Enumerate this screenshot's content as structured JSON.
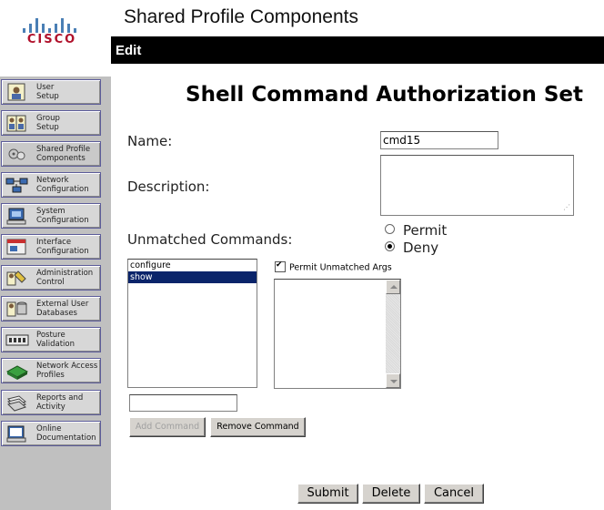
{
  "header": {
    "page_title": "Shared Profile Components",
    "edit_label": "Edit"
  },
  "logo": {
    "text": "CISCO",
    "color": "#b0112b"
  },
  "nav": {
    "items": [
      {
        "line1": "User",
        "line2": "Setup",
        "icon": "user-icon"
      },
      {
        "line1": "Group",
        "line2": "Setup",
        "icon": "group-icon"
      },
      {
        "line1": "Shared Profile",
        "line2": "Components",
        "icon": "shared-components-icon"
      },
      {
        "line1": "Network",
        "line2": "Configuration",
        "icon": "network-icon"
      },
      {
        "line1": "System",
        "line2": "Configuration",
        "icon": "system-icon"
      },
      {
        "line1": "Interface",
        "line2": "Configuration",
        "icon": "interface-icon"
      },
      {
        "line1": "Administration",
        "line2": "Control",
        "icon": "admin-icon"
      },
      {
        "line1": "External User",
        "line2": "Databases",
        "icon": "database-icon"
      },
      {
        "line1": "Posture",
        "line2": "Validation",
        "icon": "posture-icon"
      },
      {
        "line1": "Network Access",
        "line2": "Profiles",
        "icon": "network-access-icon"
      },
      {
        "line1": "Reports and",
        "line2": "Activity",
        "icon": "reports-icon"
      },
      {
        "line1": "Online",
        "line2": "Documentation",
        "icon": "docs-icon"
      }
    ]
  },
  "form": {
    "title": "Shell Command Authorization Set",
    "name_label": "Name:",
    "name_value": "cmd15",
    "description_label": "Description:",
    "description_value": "",
    "unmatched_label": "Unmatched Commands:",
    "permit_label": "Permit",
    "deny_label": "Deny",
    "selected_unmatched": "Deny",
    "commands": [
      "configure",
      "show"
    ],
    "selected_command": "show",
    "permit_unmatched_args_label": "Permit Unmatched Args",
    "permit_unmatched_args_checked": true,
    "args_value": "",
    "new_command_value": "",
    "add_command_label": "Add Command",
    "remove_command_label": "Remove Command"
  },
  "actions": {
    "submit": "Submit",
    "delete": "Delete",
    "cancel": "Cancel"
  },
  "colors": {
    "selection": "#0a246a",
    "sidebar": "#c0c0c0",
    "editbar": "#000000"
  }
}
